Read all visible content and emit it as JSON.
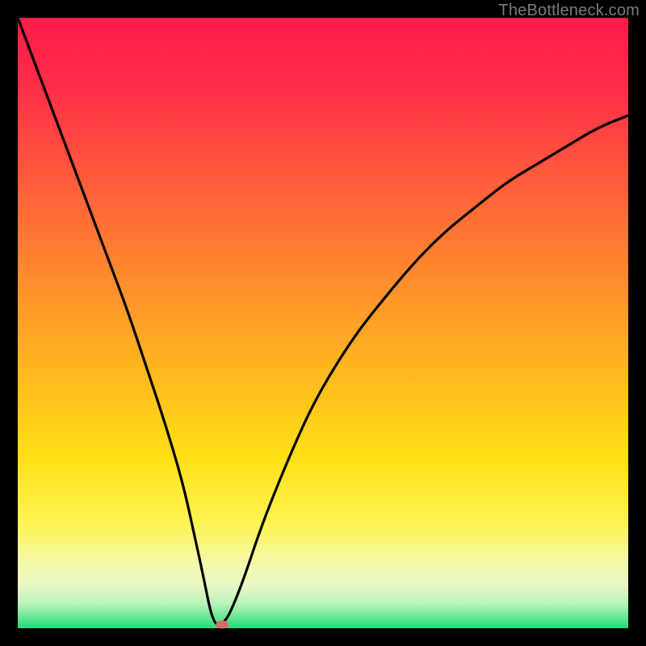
{
  "attribution": "TheBottleneck.com",
  "gradient_stops": [
    {
      "pct": 0,
      "color": "#ff1a4b"
    },
    {
      "pct": 12,
      "color": "#ff2f48"
    },
    {
      "pct": 26,
      "color": "#ff5a3c"
    },
    {
      "pct": 42,
      "color": "#ff8a2e"
    },
    {
      "pct": 58,
      "color": "#ffb81f"
    },
    {
      "pct": 72,
      "color": "#ffe015"
    },
    {
      "pct": 83,
      "color": "#fff453"
    },
    {
      "pct": 89,
      "color": "#f6f9a8"
    },
    {
      "pct": 93,
      "color": "#e9f7c6"
    },
    {
      "pct": 96,
      "color": "#b8f3b8"
    },
    {
      "pct": 98,
      "color": "#6fe89a"
    },
    {
      "pct": 100,
      "color": "#1ddb78"
    }
  ],
  "chart_data": {
    "type": "line",
    "title": "",
    "xlabel": "",
    "ylabel": "",
    "xlim": [
      0,
      100
    ],
    "ylim": [
      0,
      100
    ],
    "series": [
      {
        "name": "bottleneck-curve",
        "x": [
          0,
          3,
          6,
          9,
          12,
          15,
          18,
          21,
          24,
          27,
          29,
          30.5,
          31.5,
          32.3,
          33,
          34,
          35,
          37,
          40,
          44,
          48,
          52,
          56,
          60,
          65,
          70,
          75,
          80,
          85,
          90,
          95,
          100
        ],
        "y": [
          100,
          92,
          84,
          76,
          68,
          60,
          52,
          43,
          34,
          24,
          15,
          8,
          3,
          0.8,
          0.5,
          1.2,
          3,
          8,
          17,
          27,
          36,
          43,
          49,
          54,
          60,
          65,
          69,
          73,
          76,
          79,
          82,
          84
        ]
      }
    ],
    "marker": {
      "x": 33.5,
      "y": 0.6
    },
    "legend": false,
    "grid": false
  }
}
